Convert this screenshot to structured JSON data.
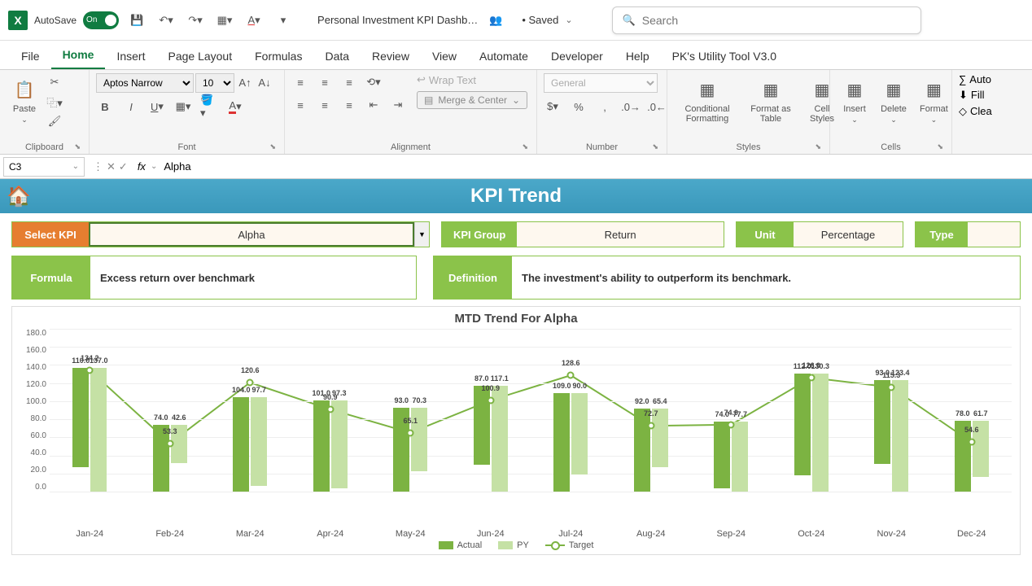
{
  "titlebar": {
    "autosave": "AutoSave",
    "toggle": "On",
    "doc_title": "Personal Investment KPI Dashb…",
    "saved": "• Saved",
    "search_placeholder": "Search"
  },
  "tabs": [
    "File",
    "Home",
    "Insert",
    "Page Layout",
    "Formulas",
    "Data",
    "Review",
    "View",
    "Automate",
    "Developer",
    "Help",
    "PK's Utility Tool V3.0"
  ],
  "ribbon": {
    "clipboard": {
      "paste": "Paste",
      "label": "Clipboard"
    },
    "font": {
      "name": "Aptos Narrow",
      "size": "10",
      "label": "Font"
    },
    "alignment": {
      "wrap": "Wrap Text",
      "merge": "Merge & Center",
      "label": "Alignment"
    },
    "number": {
      "format": "General",
      "label": "Number"
    },
    "styles": {
      "cond": "Conditional Formatting",
      "table": "Format as Table",
      "cell": "Cell Styles",
      "label": "Styles"
    },
    "cells": {
      "insert": "Insert",
      "delete": "Delete",
      "format": "Format",
      "label": "Cells"
    },
    "editing": {
      "autosum": "Auto",
      "fill": "Fill",
      "clear": "Clea"
    }
  },
  "formula_bar": {
    "cell": "C3",
    "value": "Alpha"
  },
  "dashboard": {
    "title": "KPI Trend",
    "select_kpi_label": "Select KPI",
    "select_kpi_value": "Alpha",
    "kpi_group_label": "KPI Group",
    "kpi_group_value": "Return",
    "unit_label": "Unit",
    "unit_value": "Percentage",
    "type_label": "Type",
    "formula_label": "Formula",
    "formula_value": "Excess return over benchmark",
    "definition_label": "Definition",
    "definition_value": "The investment's ability to outperform its benchmark."
  },
  "chart_data": {
    "type": "bar",
    "title": "MTD Trend For Alpha",
    "ylabel": "",
    "ylim": [
      0,
      180
    ],
    "yticks": [
      "180.0",
      "160.0",
      "140.0",
      "120.0",
      "100.0",
      "80.0",
      "60.0",
      "40.0",
      "20.0",
      "0.0"
    ],
    "categories": [
      "Jan-24",
      "Feb-24",
      "Mar-24",
      "Apr-24",
      "May-24",
      "Jun-24",
      "Jul-24",
      "Aug-24",
      "Sep-24",
      "Oct-24",
      "Nov-24",
      "Dec-24"
    ],
    "series": [
      {
        "name": "Actual",
        "values": [
          110.0,
          74.0,
          104.0,
          101.0,
          93.0,
          87.0,
          109.0,
          92.0,
          74.0,
          112.0,
          93.0,
          78.0
        ],
        "color": "#7cb342"
      },
      {
        "name": "PY",
        "values": [
          137.0,
          42.6,
          97.7,
          97.3,
          70.3,
          117.1,
          90.0,
          65.4,
          77.7,
          130.3,
          123.4,
          61.7
        ],
        "color": "#c5e1a5"
      },
      {
        "name": "Target",
        "values": [
          134.2,
          53.3,
          120.6,
          90.9,
          65.1,
          100.9,
          128.6,
          72.7,
          74.0,
          126.0,
          115.3,
          54.6
        ],
        "color": "#7cb342",
        "type": "line"
      }
    ],
    "legend": [
      "Actual",
      "PY",
      "Target"
    ]
  }
}
